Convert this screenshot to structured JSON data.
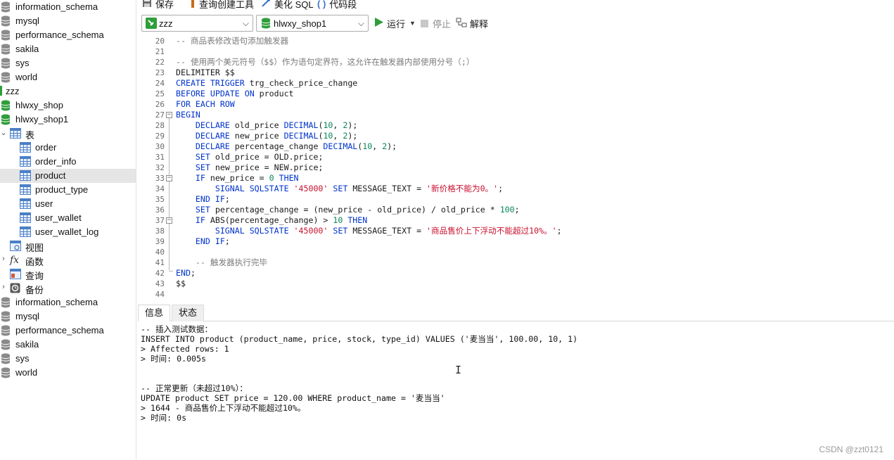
{
  "sidebar": {
    "items": [
      {
        "label": "information_schema",
        "kind": "db-gray"
      },
      {
        "label": "mysql",
        "kind": "db-gray"
      },
      {
        "label": "performance_schema",
        "kind": "db-gray"
      },
      {
        "label": "sakila",
        "kind": "db-gray"
      },
      {
        "label": "sys",
        "kind": "db-gray"
      },
      {
        "label": "world",
        "kind": "db-gray"
      },
      {
        "label": "zzz",
        "kind": "connection"
      },
      {
        "label": "hlwxy_shop",
        "kind": "db-green"
      },
      {
        "label": "hlwxy_shop1",
        "kind": "db-green"
      },
      {
        "label": "表",
        "kind": "tables-folder"
      },
      {
        "label": "order",
        "kind": "table"
      },
      {
        "label": "order_info",
        "kind": "table"
      },
      {
        "label": "product",
        "kind": "table",
        "selected": true
      },
      {
        "label": "product_type",
        "kind": "table"
      },
      {
        "label": "user",
        "kind": "table"
      },
      {
        "label": "user_wallet",
        "kind": "table"
      },
      {
        "label": "user_wallet_log",
        "kind": "table"
      },
      {
        "label": "视图",
        "kind": "views-folder"
      },
      {
        "label": "函数",
        "kind": "functions-folder"
      },
      {
        "label": "查询",
        "kind": "queries-folder"
      },
      {
        "label": "备份",
        "kind": "backups-folder"
      },
      {
        "label": "information_schema",
        "kind": "db-gray"
      },
      {
        "label": "mysql",
        "kind": "db-gray"
      },
      {
        "label": "performance_schema",
        "kind": "db-gray"
      },
      {
        "label": "sakila",
        "kind": "db-gray"
      },
      {
        "label": "sys",
        "kind": "db-gray"
      },
      {
        "label": "world",
        "kind": "db-gray"
      }
    ]
  },
  "toolbar": {
    "save": "保存",
    "query_builder": "查询创建工具",
    "beautify": "美化 SQL",
    "snippet": "代码段",
    "connection": "zzz",
    "database": "hlwxy_shop1",
    "run": "运行",
    "stop": "停止",
    "explain": "解释"
  },
  "editor": {
    "lines": [
      {
        "n": "20",
        "parts": [
          [
            "c",
            "-- 商品表修改语句添加触发器"
          ]
        ]
      },
      {
        "n": "21",
        "parts": []
      },
      {
        "n": "22",
        "parts": [
          [
            "c",
            "-- 使用两个美元符号（$$）作为语句定界符，这允许在触发器内部使用分号（;）"
          ]
        ]
      },
      {
        "n": "23",
        "parts": [
          [
            "p",
            "DELIMITER $$"
          ]
        ]
      },
      {
        "n": "24",
        "parts": [
          [
            "k",
            "CREATE TRIGGER"
          ],
          [
            "p",
            " trg_check_price_change"
          ]
        ]
      },
      {
        "n": "25",
        "parts": [
          [
            "k",
            "BEFORE UPDATE ON"
          ],
          [
            "p",
            " product"
          ]
        ]
      },
      {
        "n": "26",
        "parts": [
          [
            "k",
            "FOR EACH ROW"
          ]
        ]
      },
      {
        "n": "27",
        "parts": [
          [
            "k",
            "BEGIN"
          ]
        ]
      },
      {
        "n": "28",
        "parts": [
          [
            "p",
            "    "
          ],
          [
            "k",
            "DECLARE"
          ],
          [
            "p",
            " old_price "
          ],
          [
            "k",
            "DECIMAL"
          ],
          [
            "p",
            "("
          ],
          [
            "n",
            "10"
          ],
          [
            "p",
            ", "
          ],
          [
            "n",
            "2"
          ],
          [
            "p",
            ");"
          ]
        ]
      },
      {
        "n": "29",
        "parts": [
          [
            "p",
            "    "
          ],
          [
            "k",
            "DECLARE"
          ],
          [
            "p",
            " new_price "
          ],
          [
            "k",
            "DECIMAL"
          ],
          [
            "p",
            "("
          ],
          [
            "n",
            "10"
          ],
          [
            "p",
            ", "
          ],
          [
            "n",
            "2"
          ],
          [
            "p",
            ");"
          ]
        ]
      },
      {
        "n": "30",
        "parts": [
          [
            "p",
            "    "
          ],
          [
            "k",
            "DECLARE"
          ],
          [
            "p",
            " percentage_change "
          ],
          [
            "k",
            "DECIMAL"
          ],
          [
            "p",
            "("
          ],
          [
            "n",
            "10"
          ],
          [
            "p",
            ", "
          ],
          [
            "n",
            "2"
          ],
          [
            "p",
            ");"
          ]
        ]
      },
      {
        "n": "31",
        "parts": [
          [
            "p",
            "    "
          ],
          [
            "k",
            "SET"
          ],
          [
            "p",
            " old_price = OLD.price;"
          ]
        ]
      },
      {
        "n": "32",
        "parts": [
          [
            "p",
            "    "
          ],
          [
            "k",
            "SET"
          ],
          [
            "p",
            " new_price = NEW.price;"
          ]
        ]
      },
      {
        "n": "33",
        "parts": [
          [
            "p",
            "    "
          ],
          [
            "k",
            "IF"
          ],
          [
            "p",
            " new_price = "
          ],
          [
            "n",
            "0"
          ],
          [
            "p",
            " "
          ],
          [
            "k",
            "THEN"
          ]
        ]
      },
      {
        "n": "34",
        "parts": [
          [
            "p",
            "        "
          ],
          [
            "k",
            "SIGNAL SQLSTATE"
          ],
          [
            "p",
            " "
          ],
          [
            "s",
            "'45000'"
          ],
          [
            "p",
            " "
          ],
          [
            "k",
            "SET"
          ],
          [
            "p",
            " MESSAGE_TEXT = "
          ],
          [
            "s",
            "'新价格不能为0。'"
          ],
          [
            "p",
            ";"
          ]
        ]
      },
      {
        "n": "35",
        "parts": [
          [
            "p",
            "    "
          ],
          [
            "k",
            "END IF"
          ],
          [
            "p",
            ";"
          ]
        ]
      },
      {
        "n": "36",
        "parts": [
          [
            "p",
            "    "
          ],
          [
            "k",
            "SET"
          ],
          [
            "p",
            " percentage_change = (new_price - old_price) / old_price * "
          ],
          [
            "n",
            "100"
          ],
          [
            "p",
            ";"
          ]
        ]
      },
      {
        "n": "37",
        "parts": [
          [
            "p",
            "    "
          ],
          [
            "k",
            "IF"
          ],
          [
            "p",
            " ABS(percentage_change) > "
          ],
          [
            "n",
            "10"
          ],
          [
            "p",
            " "
          ],
          [
            "k",
            "THEN"
          ]
        ]
      },
      {
        "n": "38",
        "parts": [
          [
            "p",
            "        "
          ],
          [
            "k",
            "SIGNAL SQLSTATE"
          ],
          [
            "p",
            " "
          ],
          [
            "s",
            "'45000'"
          ],
          [
            "p",
            " "
          ],
          [
            "k",
            "SET"
          ],
          [
            "p",
            " MESSAGE_TEXT = "
          ],
          [
            "s",
            "'商品售价上下浮动不能超过10%。'"
          ],
          [
            "p",
            ";"
          ]
        ]
      },
      {
        "n": "39",
        "parts": [
          [
            "p",
            "    "
          ],
          [
            "k",
            "END IF"
          ],
          [
            "p",
            ";"
          ]
        ]
      },
      {
        "n": "40",
        "parts": []
      },
      {
        "n": "41",
        "parts": [
          [
            "p",
            "    "
          ],
          [
            "c",
            "-- 触发器执行完毕"
          ]
        ]
      },
      {
        "n": "42",
        "parts": [
          [
            "k",
            "END"
          ],
          [
            "p",
            ";"
          ]
        ]
      },
      {
        "n": "43",
        "parts": [
          [
            "p",
            "$$"
          ]
        ]
      },
      {
        "n": "44",
        "parts": []
      }
    ]
  },
  "result_tabs": {
    "info": "信息",
    "status": "状态"
  },
  "output": {
    "lines": [
      "-- 插入测试数据：",
      "INSERT INTO product (product_name, price, stock, type_id) VALUES ('麦当当', 100.00, 10, 1)",
      "> Affected rows: 1",
      "> 时间: 0.005s",
      "",
      "",
      "-- 正常更新（未超过10%）：",
      "UPDATE product SET price = 120.00 WHERE product_name = '麦当当'",
      "> 1644 - 商品售价上下浮动不能超过10%。",
      "> 时间: 0s"
    ]
  },
  "watermark": "CSDN @zzt0121",
  "colors": {
    "keyword": "#0033cc",
    "number": "#098658",
    "string": "#c8102e",
    "comment": "#7a7a7a",
    "db_green": "#2e9e3a",
    "db_gray": "#8a8a8a"
  }
}
